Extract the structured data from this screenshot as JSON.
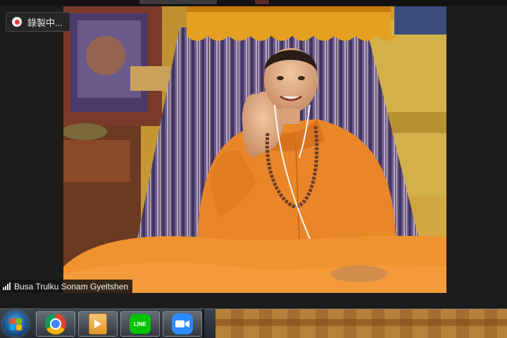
{
  "recording": {
    "label": "錄製中..."
  },
  "participant": {
    "name": "Busa Trulku Sonam Gyeltshen"
  },
  "taskbar": {
    "apps": [
      {
        "name": "Google Chrome",
        "icon": "chrome-icon"
      },
      {
        "name": "Media Player",
        "icon": "media-player-icon"
      },
      {
        "name": "LINE",
        "icon": "line-icon",
        "text": "LINE"
      },
      {
        "name": "Zoom",
        "icon": "zoom-icon"
      }
    ]
  },
  "colors": {
    "recording_dot": "#e0413a",
    "robe": "#e9862a",
    "zoom_blue": "#2d8cff",
    "line_green": "#00c300"
  }
}
